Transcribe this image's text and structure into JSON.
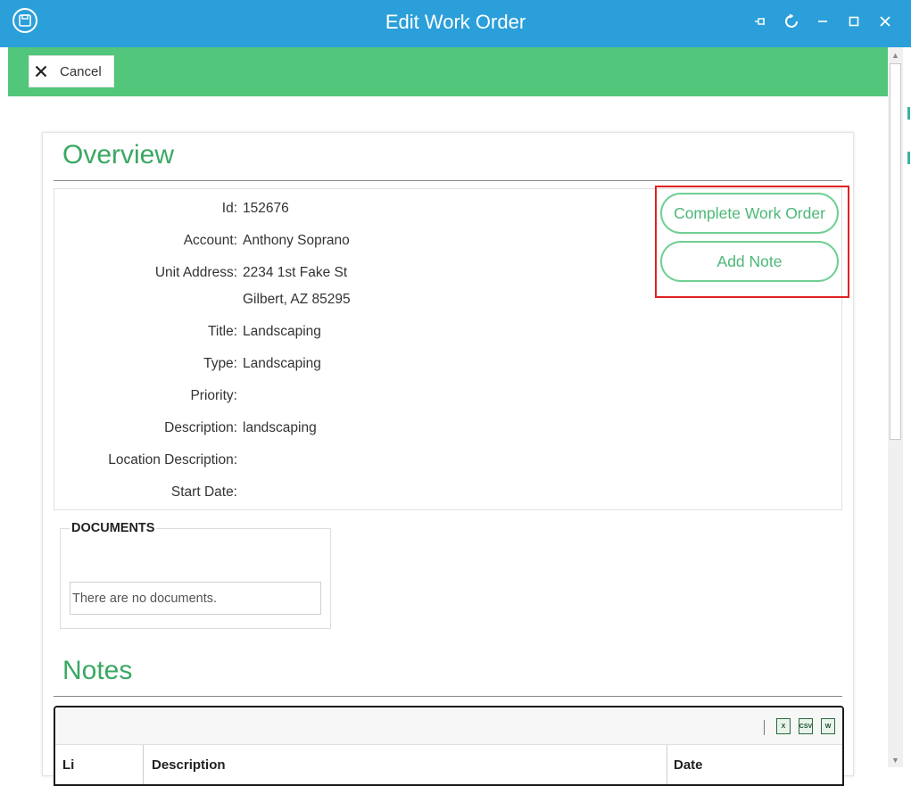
{
  "window": {
    "title": "Edit Work Order"
  },
  "toolbar": {
    "cancel_label": "Cancel"
  },
  "overview": {
    "heading": "Overview",
    "fields": [
      {
        "label": "Id:",
        "value": "152676"
      },
      {
        "label": "Account:",
        "value": "Anthony Soprano"
      },
      {
        "label": "Unit Address:",
        "value": "2234 1st Fake St"
      },
      {
        "label": "",
        "value": "Gilbert, AZ 85295"
      },
      {
        "label": "Title:",
        "value": "Landscaping"
      },
      {
        "label": "Type:",
        "value": "Landscaping"
      },
      {
        "label": "Priority:",
        "value": ""
      },
      {
        "label": "Description:",
        "value": "landscaping"
      },
      {
        "label": "Location Description:",
        "value": ""
      },
      {
        "label": "Start Date:",
        "value": ""
      }
    ],
    "actions": {
      "complete_label": "Complete Work Order",
      "add_note_label": "Add Note"
    }
  },
  "documents": {
    "legend": "DOCUMENTS",
    "empty_text": "There are no documents."
  },
  "notes": {
    "heading": "Notes",
    "columns": [
      "Li",
      "Description",
      "Date"
    ],
    "export_icons": [
      "excel-export-icon",
      "csv-export-icon",
      "word-export-icon"
    ]
  },
  "colors": {
    "titlebar": "#2b9fd9",
    "toolbar": "#52c67b",
    "accent_green": "#3aa862",
    "highlight_red": "#e02020"
  }
}
